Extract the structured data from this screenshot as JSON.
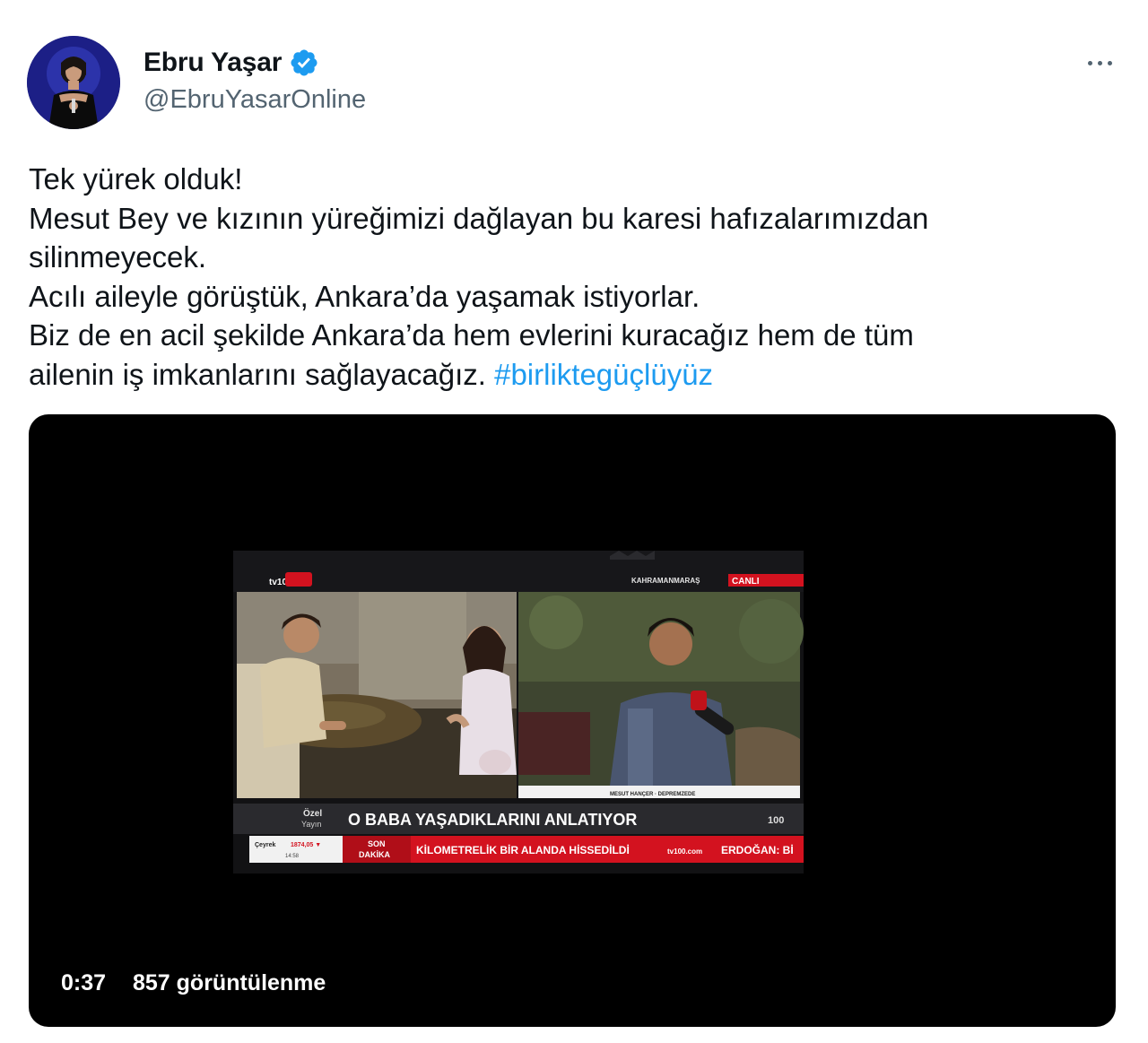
{
  "author": {
    "display_name": "Ebru Yaşar",
    "handle": "@EbruYasarOnline",
    "verified_icon": "verified-badge-icon",
    "avatar_icon": "avatar-photo"
  },
  "more_icon": "more-horizontal-icon",
  "tweet": {
    "lines": [
      "Tek yürek olduk!",
      "Mesut Bey ve kızının yüreğimizi dağlayan bu karesi hafızalarımızdan",
      "silinmeyecek.",
      "Acılı aileyle görüştük, Ankara’da yaşamak istiyorlar.",
      "Biz de en acil şekilde Ankara’da hem evlerini kuracağız hem de tüm"
    ],
    "last_line_text": "ailenin iş imkanlarını sağlayacağız. ",
    "hashtag": "#birliktegüçlüyüz"
  },
  "video": {
    "duration": "0:37",
    "views": "857 görüntülenme",
    "broadcast": {
      "channel_logo": "tv100",
      "location": "KAHRAMANMARAŞ",
      "live_badge": "CANLI",
      "special_top": "Özel",
      "special_bottom": "Yayın",
      "headline": "O BABA YAŞADIKLARINI ANLATIYOR",
      "ticker_left_label": "Çeyrek",
      "ticker_left_value": "1874,05 ▼",
      "ticker_left_sub": "14:58",
      "breaking_top": "SON",
      "breaking_bottom": "DAKİKA",
      "ticker_text": "KİLOMETRELİK BİR ALANDA HİSSEDİLDİ",
      "ticker_logo": "tv100.com",
      "ticker_next": "ERDOĞAN: Bİ",
      "lower_name": "MESUT HANÇER · DEPREMZEDE",
      "corner_logo": "100"
    },
    "colors": {
      "ticker_red": "#d3121f",
      "headline_bg": "#2a2a2e",
      "accent_blue": "#1d9bf0"
    }
  }
}
